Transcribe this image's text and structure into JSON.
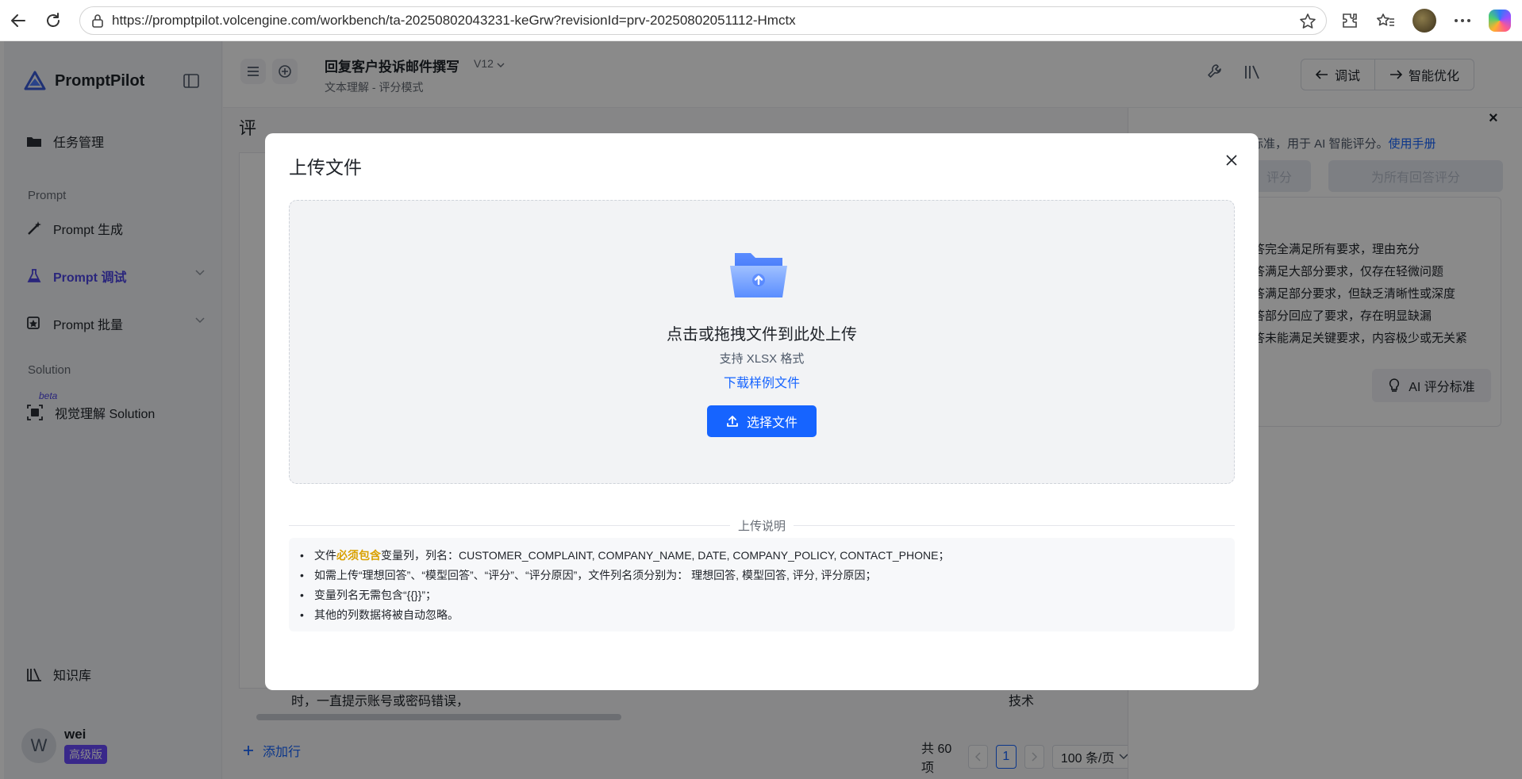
{
  "browser": {
    "url": "https://promptpilot.volcengine.com/workbench/ta-20250802043231-keGrw?revisionId=prv-20250802051112-Hmctx"
  },
  "sidebar": {
    "brand": "PromptPilot",
    "items": [
      {
        "label": "任务管理"
      },
      {
        "label": "Prompt 生成"
      },
      {
        "label": "Prompt 调试"
      },
      {
        "label": "Prompt 批量"
      },
      {
        "label": "视觉理解 Solution"
      }
    ],
    "group_prompt": "Prompt",
    "group_solution": "Solution",
    "beta": "beta",
    "knowledge": "知识库",
    "user": {
      "initial": "W",
      "name": "wei",
      "badge": "高级版"
    }
  },
  "topbar": {
    "title": "回复客户投诉邮件撰写",
    "version": "V12",
    "subtitle": "文本理解 - 评分模式",
    "debug": "调试",
    "optimize": "智能优化"
  },
  "main": {
    "eval_title_partial": "评",
    "cell_text": "时，一直提示账号或密码错误，",
    "cell_tag": "技术",
    "add_row": "添加行",
    "total": "共 60 项",
    "current_page": "1",
    "page_size": "100 条/页"
  },
  "right_panel": {
    "desc_text": "分标准，用于 AI 智能评分。",
    "desc_link": "使用手册",
    "btn_a": "评分",
    "btn_b": "为所有回答评分",
    "criteria": [
      "答完全满足所有要求，理由充分",
      "答满足大部分要求，仅存在轻微问题",
      "答满足部分要求，但缺乏清晰性或深度",
      "答部分回应了要求，存在明显缺漏",
      "答未能满足关键要求，内容极少或无关紧"
    ],
    "ai_btn": "AI 评分标准"
  },
  "modal": {
    "title": "上传文件",
    "dropzone_title": "点击或拖拽文件到此处上传",
    "dropzone_sub": "支持 XLSX 格式",
    "download_link": "下载样例文件",
    "select_btn": "选择文件",
    "notes_title": "上传说明",
    "notes": {
      "n1_pre": "文件",
      "n1_hl": "必须包含",
      "n1_post": "变量列，列名：CUSTOMER_COMPLAINT, COMPANY_NAME, DATE, COMPANY_POLICY, CONTACT_PHONE；",
      "n2": "如需上传“理想回答”、“模型回答”、“评分”、“评分原因”，文件列名须分别为： 理想回答, 模型回答, 评分, 评分原因；",
      "n3": "变量列名无需包含“{{}}”；",
      "n4": "其他的列数据将被自动忽略。"
    }
  },
  "colors": {
    "primary": "#1664ff",
    "accent_purple": "#4f46e5",
    "highlight": "#d9a100"
  }
}
